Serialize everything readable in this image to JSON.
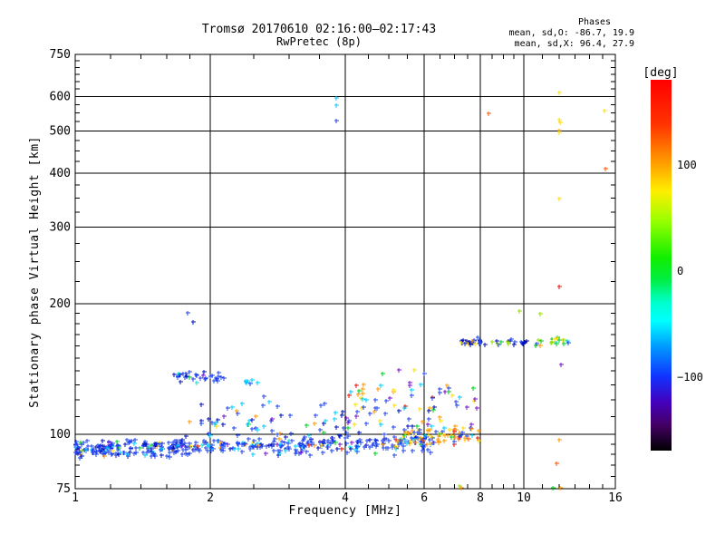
{
  "header": {
    "title_line1": "Tromsø 20170610 02:16:00–02:17:43",
    "title_line2": "RwPretec (8p)"
  },
  "stats": {
    "heading": "Phases",
    "line_o": "mean, sd,O: -86.7, 19.9",
    "line_x": "mean, sd,X:  96.4, 27.9"
  },
  "colorbar": {
    "title": "[deg]",
    "ticks": [
      {
        "label": "100",
        "value": 100
      },
      {
        "label": "0",
        "value": 0
      },
      {
        "label": "−100",
        "value": -100
      }
    ],
    "gradient_top_to_bottom": [
      {
        "o": 0,
        "c": "#ff0000"
      },
      {
        "o": 0.12,
        "c": "#ff3300"
      },
      {
        "o": 0.22,
        "c": "#ff9900"
      },
      {
        "o": 0.3,
        "c": "#ffee00"
      },
      {
        "o": 0.38,
        "c": "#99ff00"
      },
      {
        "o": 0.48,
        "c": "#11ee00"
      },
      {
        "o": 0.54,
        "c": "#00ee44"
      },
      {
        "o": 0.6,
        "c": "#00ffcc"
      },
      {
        "o": 0.65,
        "c": "#00ffff"
      },
      {
        "o": 0.72,
        "c": "#0099ff"
      },
      {
        "o": 0.8,
        "c": "#1133ff"
      },
      {
        "o": 0.87,
        "c": "#4400bb"
      },
      {
        "o": 0.93,
        "c": "#440066"
      },
      {
        "o": 1,
        "c": "#000000"
      }
    ]
  },
  "chart_data": {
    "type": "scatter",
    "title": "Tromsø 20170610 02:16:00–02:17:43",
    "subtitle": "RwPretec (8p)",
    "xlabel": "Frequency [MHz]",
    "ylabel": "Stationary phase Virtual Height [km]",
    "x_scale": "log",
    "y_scale": "log",
    "xlim": [
      1,
      16
    ],
    "ylim": [
      75,
      750
    ],
    "x_major_ticks": [
      1,
      2,
      4,
      6,
      8,
      10,
      16
    ],
    "x_minor_ticks": [
      1.2,
      1.4,
      1.6,
      1.8,
      2.5,
      3,
      3.5,
      4.5,
      5,
      5.5,
      6.5,
      7,
      7.5,
      8.5,
      9,
      9.5,
      11,
      12,
      13,
      14,
      15
    ],
    "y_major_ticks": [
      750,
      600,
      500,
      400,
      300,
      200,
      100,
      75
    ],
    "y_minor_ticks": [
      80,
      85,
      90,
      95,
      110,
      120,
      130,
      140,
      150,
      160,
      170,
      180,
      190,
      225,
      250,
      275,
      325,
      350,
      375,
      425,
      450,
      475,
      525,
      550,
      575,
      625,
      650,
      675,
      700,
      725
    ],
    "grid_x": [
      2,
      4,
      6,
      8,
      10
    ],
    "grid_y": [
      100,
      200,
      300,
      400,
      500,
      600
    ],
    "grid": true,
    "marker": "plus",
    "colors": {
      "blue": "#2244ee",
      "navy": "#0011bb",
      "cyan": "#00ccff",
      "teal": "#00e8d0",
      "green": "#00cc22",
      "greenyellow": "#99dd00",
      "yellow": "#ffdd00",
      "orange": "#ff9900",
      "orangered": "#ff5500",
      "red": "#ee1100",
      "purple": "#7711cc",
      "violet": "#4411aa"
    },
    "clusters": [
      {
        "name": "e-layer-main-band",
        "f": [
          1.0,
          6.3
        ],
        "h": [
          93,
          96
        ],
        "h_sigma": 2.2,
        "n": 430,
        "skew": 1.25,
        "color_weights": {
          "blue": 0.57,
          "navy": 0.18,
          "cyan": 0.09,
          "teal": 0.02,
          "purple": 0.04,
          "green": 0.02,
          "orange": 0.03,
          "yellow": 0.02,
          "red": 0.01,
          "greenyellow": 0.02
        }
      },
      {
        "name": "e-layer-orange-mix",
        "f": [
          5.2,
          8.0
        ],
        "h": [
          100,
          100
        ],
        "h_sigma": 2.2,
        "n": 75,
        "skew": 1,
        "color_weights": {
          "orange": 0.3,
          "yellow": 0.24,
          "blue": 0.16,
          "red": 0.08,
          "cyan": 0.08,
          "green": 0.05,
          "purple": 0.05,
          "orangered": 0.04
        }
      },
      {
        "name": "scatter-above-band",
        "f": [
          1.9,
          6.3
        ],
        "h": [
          109,
          107
        ],
        "h_sigma": 5.5,
        "n": 85,
        "skew": 1,
        "color_weights": {
          "blue": 0.44,
          "cyan": 0.18,
          "navy": 0.16,
          "purple": 0.07,
          "orange": 0.06,
          "yellow": 0.05,
          "green": 0.04
        }
      },
      {
        "name": "mid-colorful-scatter",
        "f": [
          4.0,
          7.9
        ],
        "h": [
          124,
          122
        ],
        "h_sigma": 8,
        "n": 60,
        "skew": 1,
        "color_weights": {
          "blue": 0.22,
          "cyan": 0.14,
          "orange": 0.18,
          "yellow": 0.16,
          "red": 0.08,
          "purple": 0.11,
          "green": 0.07,
          "navy": 0.04
        }
      },
      {
        "name": "es-cluster-2mhz",
        "f": [
          1.65,
          2.15
        ],
        "h": [
          137,
          135
        ],
        "h_sigma": 2.2,
        "n": 32,
        "skew": 1,
        "color_weights": {
          "blue": 0.5,
          "navy": 0.3,
          "green": 0.08,
          "teal": 0.06,
          "purple": 0.06
        }
      },
      {
        "name": "small-cyan-cluster",
        "f": [
          2.35,
          2.56
        ],
        "h": [
          133,
          132
        ],
        "h_sigma": 1.8,
        "n": 7,
        "skew": 1,
        "color_weights": {
          "cyan": 0.5,
          "blue": 0.5
        }
      },
      {
        "name": "f-band-dense",
        "f": [
          7.25,
          8.05
        ],
        "h": [
          163,
          164
        ],
        "h_sigma": 1.5,
        "n": 26,
        "skew": 1,
        "color_weights": {
          "blue": 0.42,
          "navy": 0.34,
          "orange": 0.12,
          "yellow": 0.12
        }
      },
      {
        "name": "f-band-sparse",
        "f": [
          8.2,
          9.6
        ],
        "h": [
          163,
          163
        ],
        "h_sigma": 1.4,
        "n": 13,
        "skew": 1,
        "color_weights": {
          "blue": 0.3,
          "navy": 0.22,
          "purple": 0.2,
          "greenyellow": 0.15,
          "green": 0.13
        }
      },
      {
        "name": "f-band-10mhz",
        "f": [
          9.85,
          10.15
        ],
        "h": [
          163,
          163
        ],
        "h_sigma": 1.1,
        "n": 6,
        "skew": 1,
        "color_weights": {
          "navy": 0.6,
          "blue": 0.4
        }
      },
      {
        "name": "f-band-high",
        "f": [
          10.6,
          12.8
        ],
        "h": [
          163,
          164
        ],
        "h_sigma": 1.8,
        "n": 20,
        "skew": 1,
        "color_weights": {
          "cyan": 0.18,
          "blue": 0.25,
          "green": 0.12,
          "yellow": 0.18,
          "greenyellow": 0.1,
          "purple": 0.1,
          "orange": 0.07
        }
      }
    ],
    "points": [
      [
        3.82,
        595,
        "cyan"
      ],
      [
        3.82,
        574,
        "cyan"
      ],
      [
        3.82,
        528,
        "blue"
      ],
      [
        8.34,
        549,
        "orangered"
      ],
      [
        12.0,
        612,
        "yellow"
      ],
      [
        15.1,
        558,
        "yellow"
      ],
      [
        12.0,
        531,
        "yellow"
      ],
      [
        12.05,
        523,
        "yellow"
      ],
      [
        12.0,
        501,
        "orange"
      ],
      [
        12.0,
        495,
        "yellow"
      ],
      [
        15.2,
        409,
        "orangered"
      ],
      [
        12.0,
        350,
        "yellow"
      ],
      [
        12.0,
        219,
        "red"
      ],
      [
        9.77,
        192,
        "greenyellow"
      ],
      [
        10.85,
        190,
        "greenyellow"
      ],
      [
        12.1,
        145,
        "purple"
      ],
      [
        1.78,
        191,
        "blue"
      ],
      [
        1.83,
        182,
        "navy"
      ],
      [
        1.8,
        107,
        "orange"
      ],
      [
        1.16,
        89,
        "orange"
      ],
      [
        1.03,
        96,
        "green"
      ],
      [
        12.0,
        97,
        "orange"
      ],
      [
        11.8,
        86,
        "orangered"
      ],
      [
        11.6,
        75.5,
        "green"
      ],
      [
        12.05,
        75.3,
        "orange"
      ],
      [
        7.2,
        76,
        "greenyellow"
      ],
      [
        7.26,
        75.5,
        "orange"
      ]
    ]
  }
}
